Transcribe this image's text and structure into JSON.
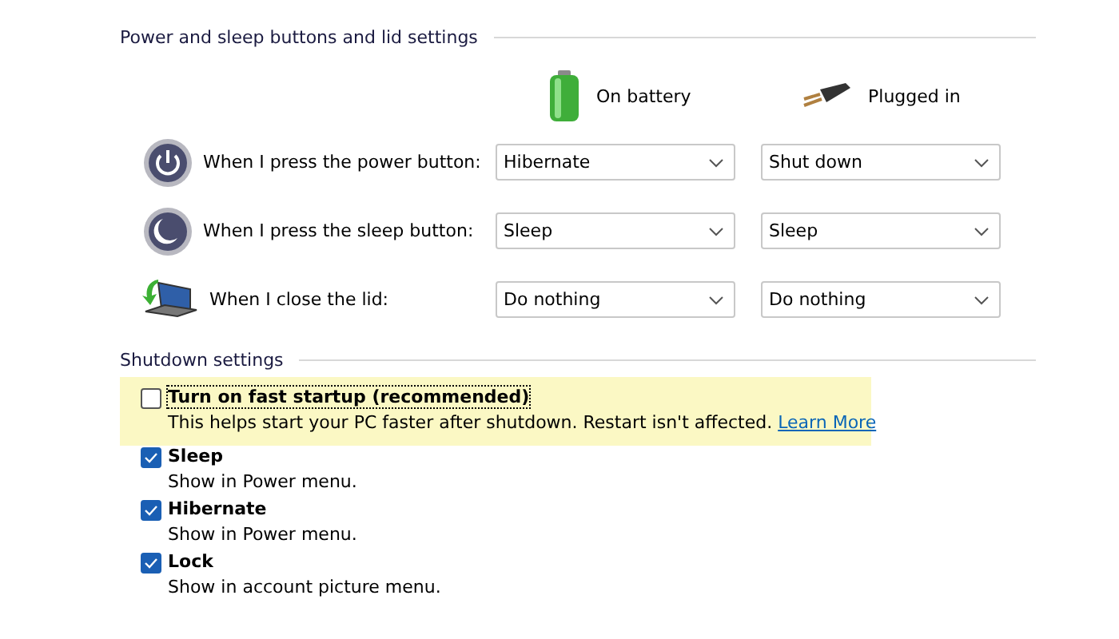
{
  "buttons_section": {
    "title": "Power and sleep buttons and lid settings",
    "columns": [
      {
        "kind": "battery",
        "label": "On battery"
      },
      {
        "kind": "plug",
        "label": "Plugged in"
      }
    ],
    "rows": [
      {
        "kind": "power",
        "label": "When I press the power button:",
        "values": [
          "Hibernate",
          "Shut down"
        ]
      },
      {
        "kind": "sleep",
        "label": "When I press the sleep button:",
        "values": [
          "Sleep",
          "Sleep"
        ]
      },
      {
        "kind": "lid",
        "label": "When I close the lid:",
        "values": [
          "Do nothing",
          "Do nothing"
        ]
      }
    ]
  },
  "shutdown_section": {
    "title": "Shutdown settings",
    "options": [
      {
        "label": "Turn on fast startup (recommended)",
        "description": "This helps start your PC faster after shutdown. Restart isn't affected.",
        "link": "Learn More",
        "checked": false,
        "highlighted": true
      },
      {
        "label": "Sleep",
        "description": "Show in Power menu.",
        "checked": true,
        "highlighted": false
      },
      {
        "label": "Hibernate",
        "description": "Show in Power menu.",
        "checked": true,
        "highlighted": false
      },
      {
        "label": "Lock",
        "description": "Show in account picture menu.",
        "checked": true,
        "highlighted": false
      }
    ]
  }
}
